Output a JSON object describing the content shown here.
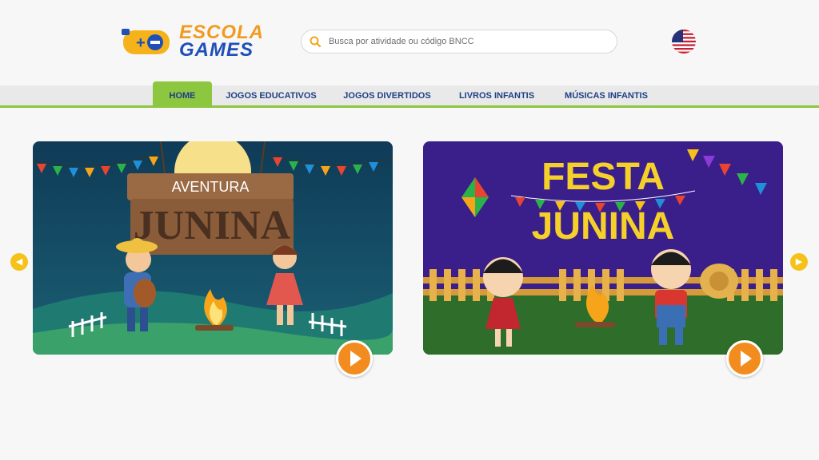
{
  "logo": {
    "line1": "ESCOLA",
    "line2": "GAMES"
  },
  "search": {
    "placeholder": "Busca por atividade ou código BNCC"
  },
  "language": {
    "flag": "us-flag-icon"
  },
  "nav": {
    "items": [
      {
        "label": "HOME",
        "active": true
      },
      {
        "label": "JOGOS EDUCATIVOS"
      },
      {
        "label": "JOGOS DIVERTIDOS"
      },
      {
        "label": "LIVROS INFANTIS"
      },
      {
        "label": "MÚSICAS INFANTIS"
      }
    ]
  },
  "carousel": {
    "prev_icon": "chevron-left-icon",
    "next_icon": "chevron-right-icon",
    "cards": [
      {
        "title_line1": "AVENTURA",
        "title_line2": "JUNINA"
      },
      {
        "title_line1": "FESTA",
        "title_line2": "JUNINA"
      }
    ]
  },
  "colors": {
    "accent_green": "#8dc63f",
    "nav_text": "#1f3f87",
    "play_orange": "#f28c1f",
    "arrow_yellow": "#f6c21a"
  }
}
